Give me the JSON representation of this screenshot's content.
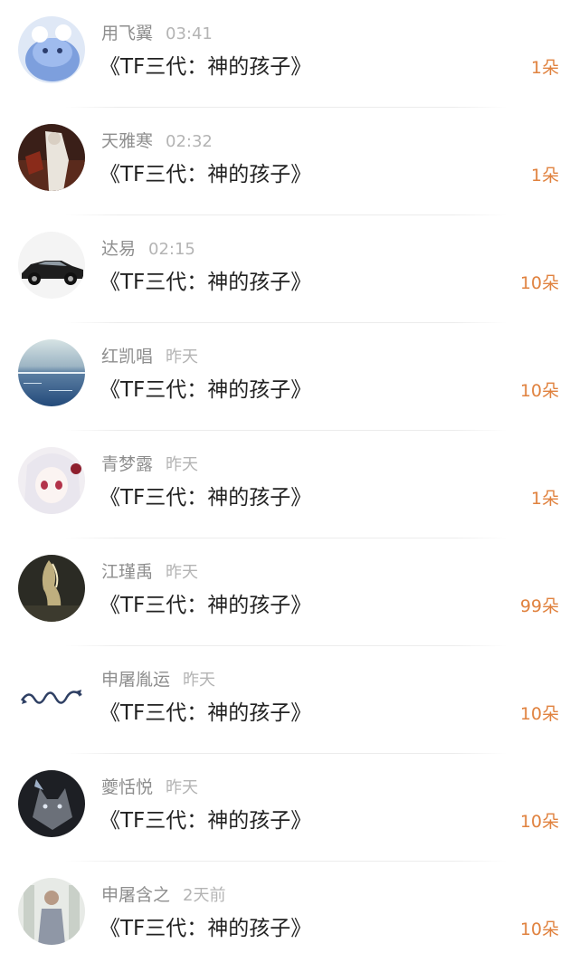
{
  "gift_list": {
    "entries": [
      {
        "name": "用飞翼",
        "time": "03:41",
        "gift": "《TF三代：神的孩子》",
        "count": "1朵",
        "avatar": "cartoon-blob-avatar"
      },
      {
        "name": "天雅寒",
        "time": "02:32",
        "gift": "《TF三代：神的孩子》",
        "count": "1朵",
        "avatar": "dark-scene-avatar"
      },
      {
        "name": "达易",
        "time": "02:15",
        "gift": "《TF三代：神的孩子》",
        "count": "10朵",
        "avatar": "classic-car-avatar"
      },
      {
        "name": "红凯唱",
        "time": "昨天",
        "gift": "《TF三代：神的孩子》",
        "count": "10朵",
        "avatar": "ocean-avatar"
      },
      {
        "name": "青梦露",
        "time": "昨天",
        "gift": "《TF三代：神的孩子》",
        "count": "1朵",
        "avatar": "anime-girl-avatar"
      },
      {
        "name": "江瑾禹",
        "time": "昨天",
        "gift": "《TF三代：神的孩子》",
        "count": "99朵",
        "avatar": "golden-figure-avatar"
      },
      {
        "name": "申屠胤运",
        "time": "昨天",
        "gift": "《TF三代：神的孩子》",
        "count": "10朵",
        "avatar": "signature-avatar"
      },
      {
        "name": "夔恬悦",
        "time": "昨天",
        "gift": "《TF三代：神的孩子》",
        "count": "10朵",
        "avatar": "wolf-avatar"
      },
      {
        "name": "申屠含之",
        "time": "2天前",
        "gift": "《TF三代：神的孩子》",
        "count": "10朵",
        "avatar": "person-photo-avatar"
      }
    ]
  },
  "colors": {
    "name": "#8e8e8e",
    "time": "#b4b4b4",
    "gift_title": "#222222",
    "flower_count": "#e0823f"
  }
}
